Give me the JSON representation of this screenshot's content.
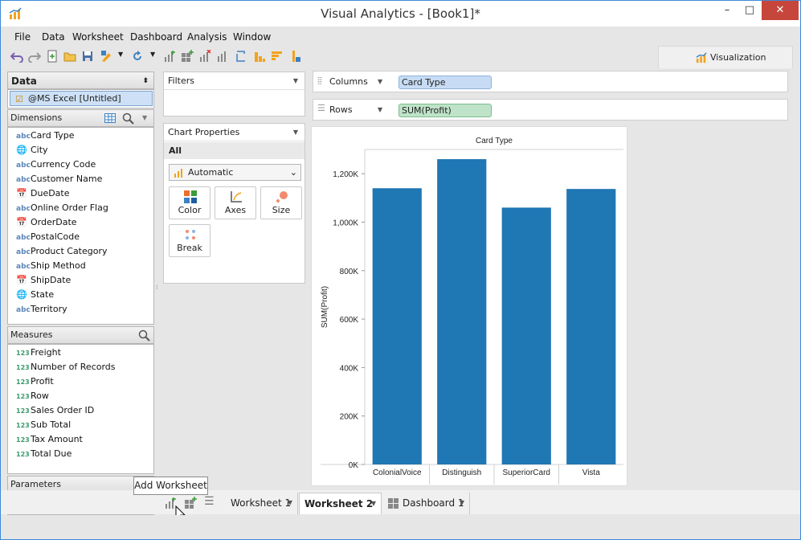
{
  "window": {
    "title": "Visual Analytics - [Book1]*"
  },
  "menu": [
    "File",
    "Data",
    "Worksheet",
    "Dashboard",
    "Analysis",
    "Window"
  ],
  "viz_tab": {
    "label": "Visualization"
  },
  "data_panel": {
    "title": "Data",
    "source": "@MS Excel [Untitled]",
    "dimensions_title": "Dimensions",
    "dimensions": [
      {
        "icon": "abc",
        "label": "Card Type"
      },
      {
        "icon": "globe",
        "label": "City"
      },
      {
        "icon": "abc",
        "label": "Currency Code"
      },
      {
        "icon": "abc",
        "label": "Customer Name"
      },
      {
        "icon": "date",
        "label": "DueDate"
      },
      {
        "icon": "abc",
        "label": "Online Order Flag"
      },
      {
        "icon": "date",
        "label": "OrderDate"
      },
      {
        "icon": "abc",
        "label": "PostalCode"
      },
      {
        "icon": "abc",
        "label": "Product Category"
      },
      {
        "icon": "abc",
        "label": "Ship Method"
      },
      {
        "icon": "date",
        "label": "ShipDate"
      },
      {
        "icon": "globe",
        "label": "State"
      },
      {
        "icon": "abc",
        "label": "Territory"
      }
    ],
    "measures_title": "Measures",
    "measures": [
      {
        "icon": "123",
        "label": "Freight"
      },
      {
        "icon": "123",
        "label": "Number of Records"
      },
      {
        "icon": "123",
        "label": "Profit"
      },
      {
        "icon": "123",
        "label": "Row"
      },
      {
        "icon": "123",
        "label": "Sales Order ID"
      },
      {
        "icon": "123",
        "label": "Sub Total"
      },
      {
        "icon": "123",
        "label": "Tax Amount"
      },
      {
        "icon": "123",
        "label": "Total Due"
      }
    ],
    "parameters_title": "Parameters"
  },
  "filters": {
    "title": "Filters"
  },
  "chart_properties": {
    "title": "Chart Properties",
    "all_label": "All",
    "mark_type": "Automatic",
    "buttons": [
      "Color",
      "Axes",
      "Size",
      "Break"
    ]
  },
  "shelves": {
    "columns_label": "Columns",
    "columns_pill": "Card Type",
    "rows_label": "Rows",
    "rows_pill": "SUM(Profit)"
  },
  "chart_data": {
    "type": "bar",
    "title": "Card Type",
    "xlabel": "",
    "ylabel": "SUM(Profit)",
    "categories": [
      "ColonialVoice",
      "Distinguish",
      "SuperiorCard",
      "Vista"
    ],
    "values": [
      1140000,
      1260000,
      1060000,
      1137000
    ],
    "ylim": [
      0,
      1300000
    ],
    "yticks": [
      0,
      200000,
      400000,
      600000,
      800000,
      1000000,
      1200000
    ],
    "ytick_labels": [
      "0K",
      "200K",
      "400K",
      "600K",
      "800K",
      "1,000K",
      "1,200K"
    ],
    "bar_color": "#1f77b4",
    "grid": false
  },
  "tabs": [
    {
      "label": "Worksheet 1",
      "active": false
    },
    {
      "label": "Worksheet 2",
      "active": true
    },
    {
      "label": "Dashboard 1",
      "active": false
    }
  ],
  "tooltip": "Add Worksheet"
}
